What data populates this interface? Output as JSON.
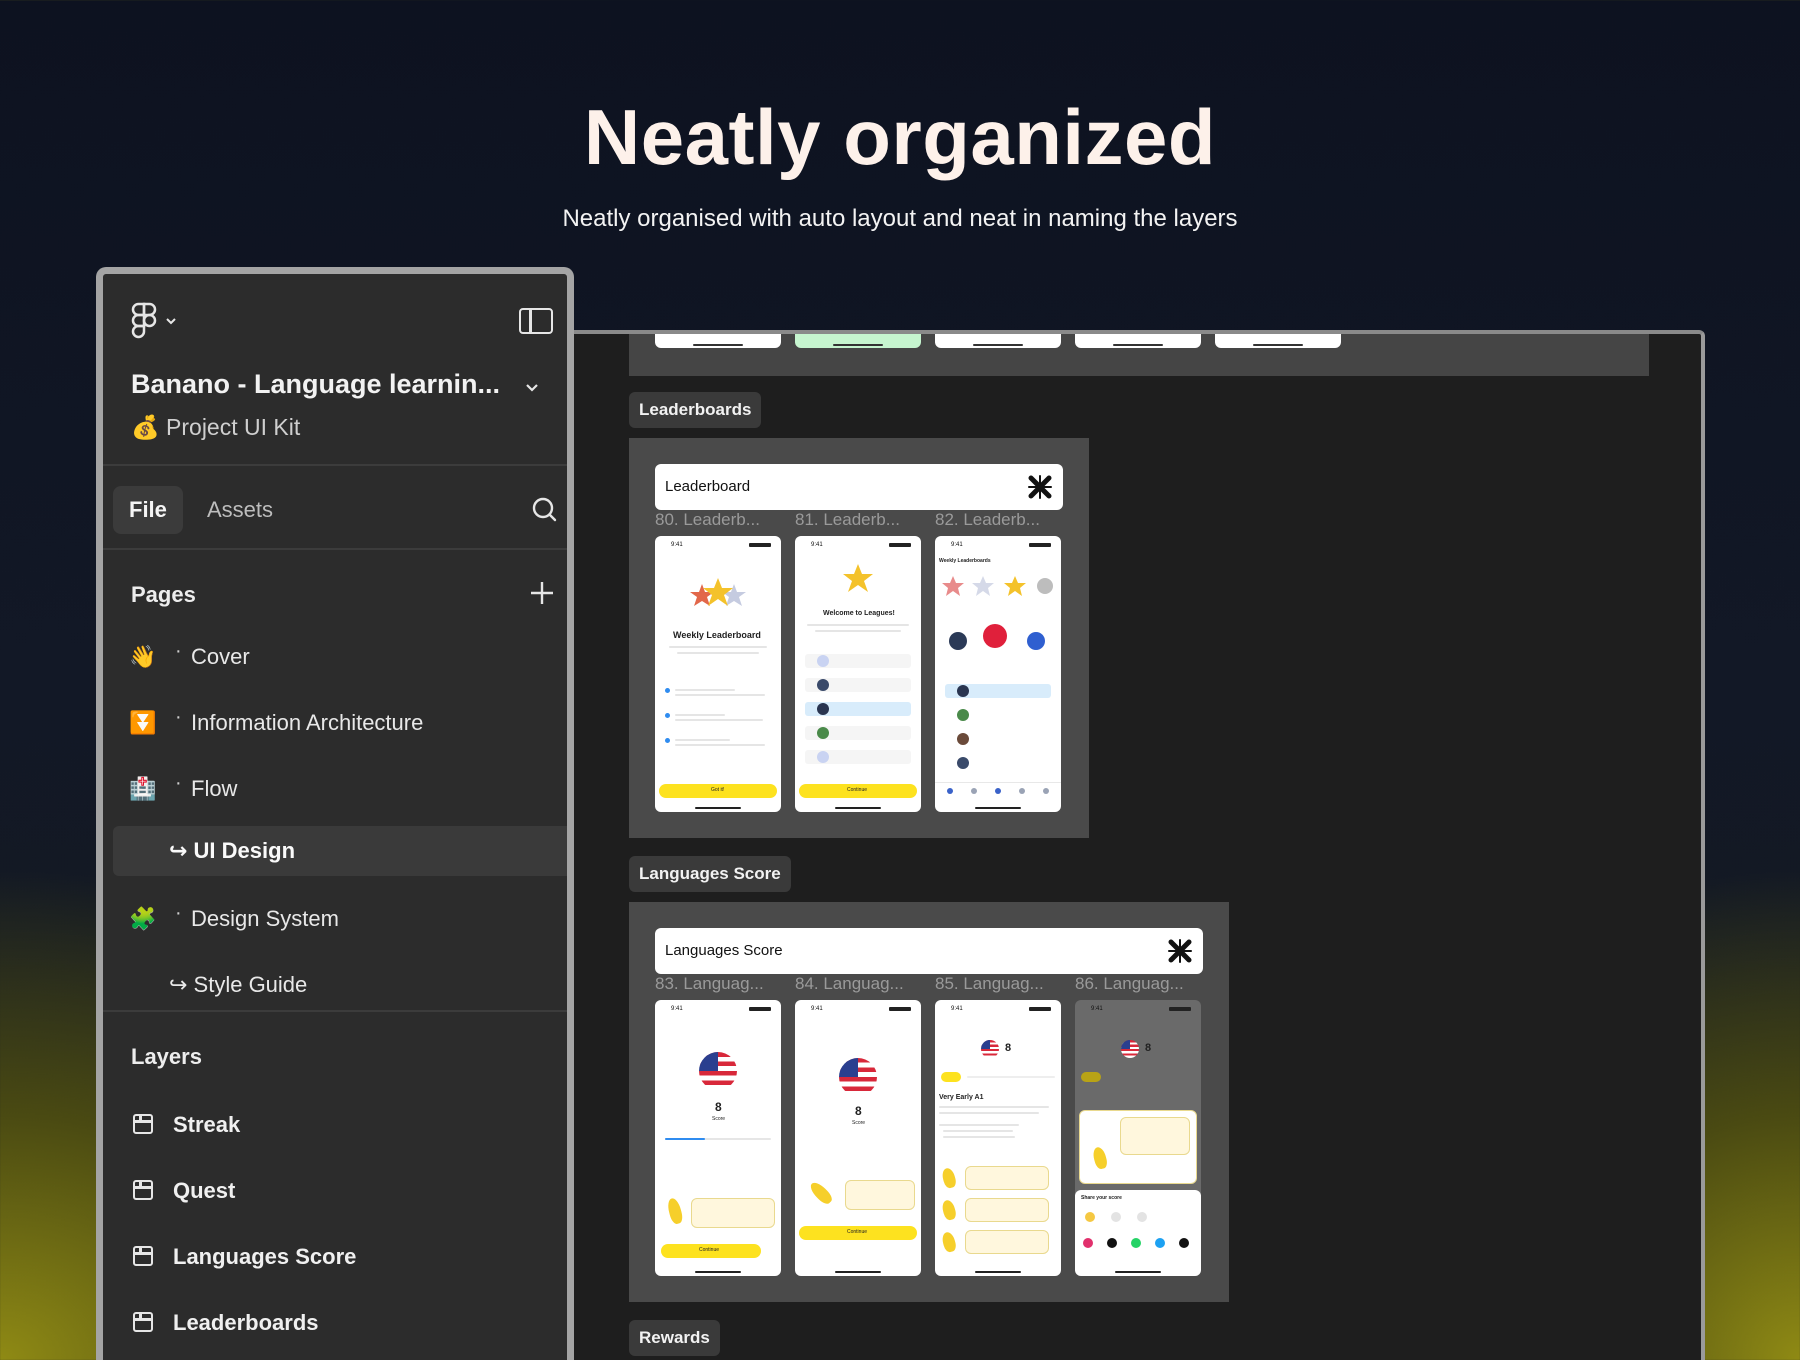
{
  "hero": {
    "title": "Neatly organized",
    "subtitle": "Neatly organised with auto layout and neat in naming the layers"
  },
  "sidebar": {
    "project_title": "Banano - Language learnin...",
    "project_sub": "💰 Project UI Kit",
    "tabs": {
      "file": "File",
      "assets": "Assets"
    },
    "pages_title": "Pages",
    "pages": [
      {
        "emoji": "👋",
        "label": "Cover"
      },
      {
        "emoji": "⏬",
        "label": "Information Architecture"
      },
      {
        "emoji": "🏥",
        "label": "Flow"
      },
      {
        "emoji": "",
        "label": "↪ UI Design"
      },
      {
        "emoji": "🧩",
        "label": "Design System"
      },
      {
        "emoji": "",
        "label": "↪ Style Guide"
      }
    ],
    "layers_title": "Layers",
    "layers": [
      {
        "label": "Streak"
      },
      {
        "label": "Quest"
      },
      {
        "label": "Languages Score"
      },
      {
        "label": "Leaderboards"
      }
    ]
  },
  "canvas": {
    "sections": [
      {
        "tag": "Leaderboards",
        "header": "Leaderboard",
        "frames": [
          "80. Leaderb...",
          "81. Leaderb...",
          "82. Leaderb..."
        ],
        "screen_texts": {
          "s80_title": "Weekly Leaderboard",
          "s81_title": "Welcome to Leagues!",
          "s82_title": "Weekly Leaderboards",
          "btn_got": "Got it!",
          "btn_continue": "Continue"
        }
      },
      {
        "tag": "Languages Score",
        "header": "Languages Score",
        "frames": [
          "83. Languag...",
          "84. Languag...",
          "85. Languag...",
          "86. Languag..."
        ],
        "screen_texts": {
          "score_value": "8",
          "score_label": "Score",
          "level": "Very Early A1",
          "share": "Share your score",
          "btn_continue": "Continue"
        }
      },
      {
        "tag": "Rewards"
      }
    ]
  },
  "colors": {
    "accent_yellow": "#fde21f",
    "panel_bg": "#2c2c2c",
    "canvas_bg": "#1e1e1e"
  }
}
